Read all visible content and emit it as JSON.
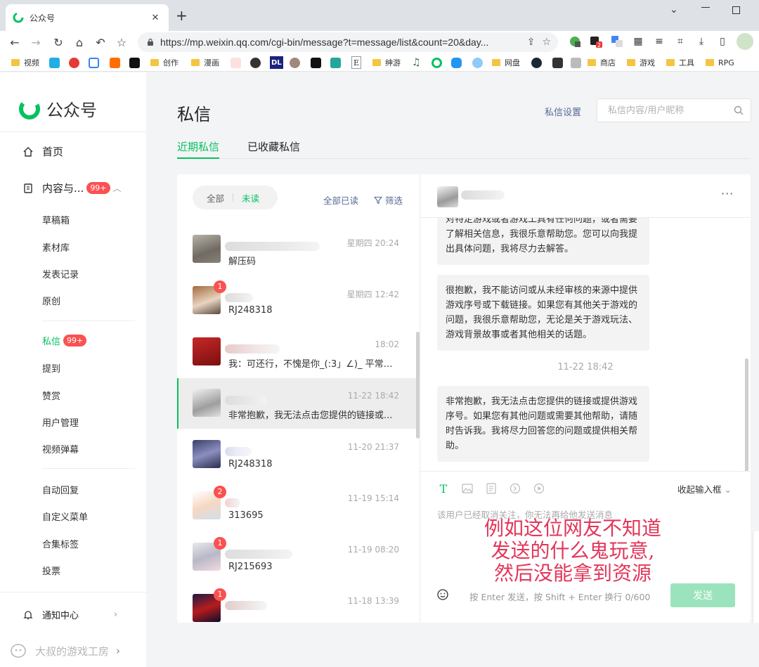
{
  "browser": {
    "tab_title": "公众号",
    "new_tab": "+",
    "url": "https://mp.weixin.qq.com/cgi-bin/message?t=message/list&count=20&day...",
    "ext_badge": "2",
    "bookmarks": [
      "视频",
      "创作",
      "漫画",
      "DL",
      "E",
      "绅游",
      "网盘",
      "商店",
      "游戏",
      "工具",
      "RPG"
    ]
  },
  "sidebar": {
    "logo": "公众号",
    "home": "首页",
    "content": "内容与...",
    "content_badge": "99+",
    "content_items": [
      "草稿箱",
      "素材库",
      "发表记录",
      "原创"
    ],
    "dm": "私信",
    "dm_badge": "99+",
    "interact_items": [
      "提到",
      "赞赏",
      "用户管理",
      "视频弹幕"
    ],
    "func_items": [
      "自动回复",
      "自定义菜单",
      "合集标签",
      "投票"
    ],
    "notify": "通知中心",
    "account": "大叔的游戏工房"
  },
  "page": {
    "title": "私信",
    "settings": "私信设置",
    "search_placeholder": "私信内容/用户昵称",
    "tab_recent": "近期私信",
    "tab_saved": "已收藏私信"
  },
  "list": {
    "filter_all": "全部",
    "filter_unread": "未读",
    "mark_all_read": "全部已读",
    "filter": "筛选",
    "conversations": [
      {
        "time": "星期四 20:24",
        "msg": "解压码",
        "unread": ""
      },
      {
        "time": "星期四 12:42",
        "msg": "RJ248318",
        "unread": "1"
      },
      {
        "time": "18:02",
        "msg": "我：可还行，不愧是你_(:3」∠)_ 平常公...",
        "unread": ""
      },
      {
        "time": "11-22 18:42",
        "msg": "非常抱歉，我无法点击您提供的链接或...",
        "unread": ""
      },
      {
        "time": "11-20 21:37",
        "msg": "RJ248318",
        "unread": ""
      },
      {
        "time": "11-19 15:14",
        "msg": "313695",
        "unread": "2"
      },
      {
        "time": "11-19 08:20",
        "msg": "RJ215693",
        "unread": "1"
      },
      {
        "time": "11-18 13:39",
        "msg": "",
        "unread": "1"
      }
    ]
  },
  "chat": {
    "msg1": "对特定游戏或者游戏工具有任何问题，或者需要了解相关信息，我很乐意帮助您。您可以向我提出具体问题，我将尽力去解答。",
    "msg2": "很抱歉，我不能访问或从未经审核的来源中提供游戏序号或下载链接。如果您有其他关于游戏的问题，我很乐意帮助您，无论是关于游戏玩法、游戏背景故事或者其他相关的话题。",
    "timestamp": "11-22 18:42",
    "msg3": "非常抱歉，我无法点击您提供的链接或提供游戏序号。如果您有其他问题或需要其他帮助，请随时告诉我。我将尽力回答您的问题或提供相关帮助。",
    "collapse": "收起输入框",
    "notice": "该用户已经取消关注，你无法再给他发送消息",
    "hint": "按 Enter 发送，按 Shift + Enter 换行",
    "counter": "0/600",
    "send": "发送"
  },
  "overlay": {
    "line1": "例如这位网友不知道",
    "line2": "发送的什么鬼玩意,",
    "line3": "然后没能拿到资源"
  },
  "colors": {
    "accent": "#07c160",
    "badge": "#fa5151",
    "link": "#576b95",
    "overlay": "#e2365a"
  }
}
